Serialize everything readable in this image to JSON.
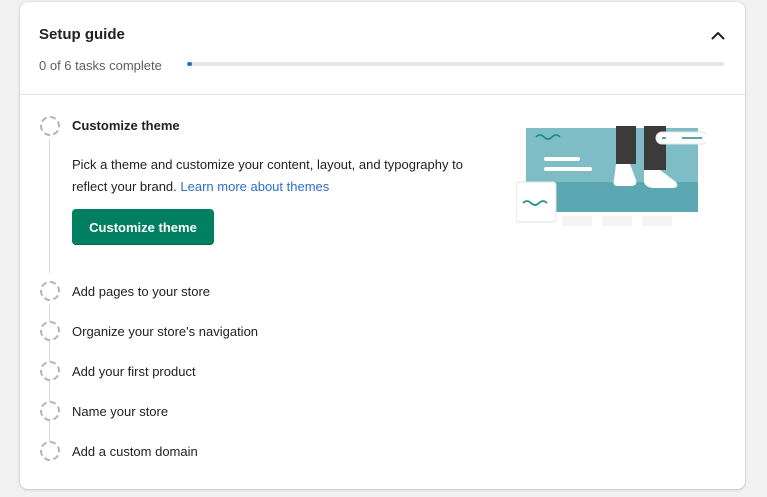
{
  "header": {
    "title": "Setup guide",
    "progress_text": "0 of 6 tasks complete",
    "progress_completed": 0,
    "progress_total": 6
  },
  "active_task": {
    "label": "Customize theme",
    "description": "Pick a theme and customize your content, layout, and typography to reflect your brand.",
    "link_text": "Learn more about themes",
    "button_label": "Customize theme"
  },
  "tasks": [
    {
      "label": "Add pages to your store"
    },
    {
      "label": "Organize your store's navigation"
    },
    {
      "label": "Add your first product"
    },
    {
      "label": "Name your store"
    },
    {
      "label": "Add a custom domain"
    }
  ],
  "colors": {
    "primary_button": "#008060",
    "link": "#2c6ecb",
    "illustration_teal": "#7fbdc6"
  }
}
